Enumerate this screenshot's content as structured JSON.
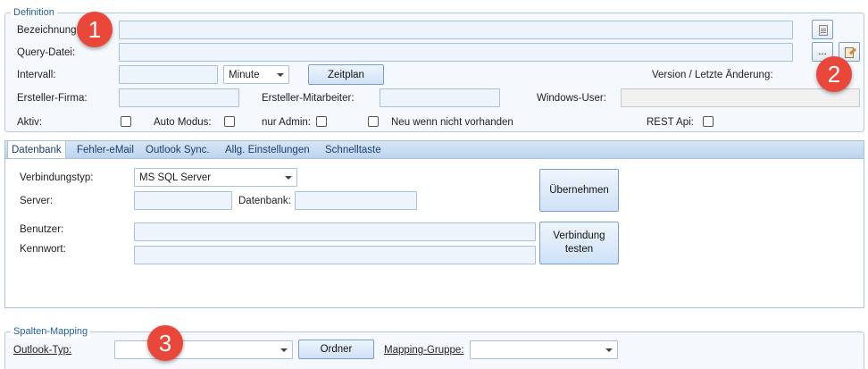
{
  "definition": {
    "group_title": "Definition",
    "bezeichnung_label": "Bezeichnung:",
    "bezeichnung_value": "",
    "query_label": "Query-Datei:",
    "query_value": "",
    "browse_label": "...",
    "intervall_label": "Intervall:",
    "intervall_value": "",
    "intervall_unit": "Minute",
    "zeitplan_label": "Zeitplan",
    "version_label": "Version / Letzte Änderung:",
    "firma_label": "Ersteller-Firma:",
    "firma_value": "",
    "mitarbeiter_label": "Ersteller-Mitarbeiter:",
    "mitarbeiter_value": "",
    "windows_user_label": "Windows-User:",
    "windows_user_value": "",
    "aktiv_label": "Aktiv:",
    "auto_modus_label": "Auto Modus:",
    "nur_admin_label": "nur Admin:",
    "neu_label": "Neu wenn nicht vorhanden",
    "rest_api_label": "REST Api:",
    "icons": [
      "document-icon",
      "edit-document-icon"
    ]
  },
  "tabs": [
    {
      "label": "Datenbank",
      "active": true
    },
    {
      "label": "Fehler-eMail",
      "active": false
    },
    {
      "label": "Outlook Sync.",
      "active": false
    },
    {
      "label": "Allg. Einstellungen",
      "active": false
    },
    {
      "label": "Schnelltaste",
      "active": false
    }
  ],
  "datenbank": {
    "verbindungstyp_label": "Verbindungstyp:",
    "verbindungstyp_value": "MS SQL Server",
    "server_label": "Server:",
    "server_value": "",
    "datenbank_label": "Datenbank:",
    "datenbank_value": "",
    "benutzer_label": "Benutzer:",
    "benutzer_value": "",
    "kennwort_label": "Kennwort:",
    "kennwort_value": "",
    "uebernehmen_label": "Übernehmen",
    "verbindung_testen_label": "Verbindung\ntesten"
  },
  "spalten_mapping": {
    "group_title": "Spalten-Mapping",
    "outlook_typ_label": "Outlook-Typ:",
    "outlook_typ_value": "",
    "ordner_label": "Ordner",
    "mapping_gruppe_label": "Mapping-Gruppe:",
    "mapping_gruppe_value": ""
  },
  "callouts": [
    "1",
    "2",
    "3"
  ],
  "colors": {
    "accent": "#1f5fa8",
    "input_bg": "#eef4fb",
    "input_border": "#a9c2dc",
    "callout": "#e8473a"
  }
}
